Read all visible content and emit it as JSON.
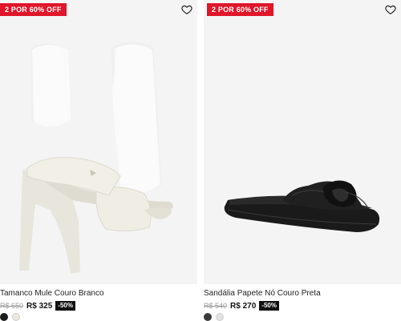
{
  "products": [
    {
      "badge": "2 POR 60% OFF",
      "name": "Tamanco Mule Couro Branco",
      "old_price": "R$ 650",
      "price": "R$ 325",
      "discount": "-50%",
      "swatches": [
        "#1c1c1c",
        "#ece8da"
      ]
    },
    {
      "badge": "2 POR 60% OFF",
      "name": "Sandália Papete Nó Couro Preta",
      "old_price": "R$ 540",
      "price": "R$ 270",
      "discount": "-50%",
      "swatches": [
        "#3a3a3a",
        "#e2e2e2"
      ]
    }
  ],
  "colors": {
    "badge": "#e0162b",
    "discount_bg": "#111111",
    "photo_bg": "#f4f4f4"
  }
}
